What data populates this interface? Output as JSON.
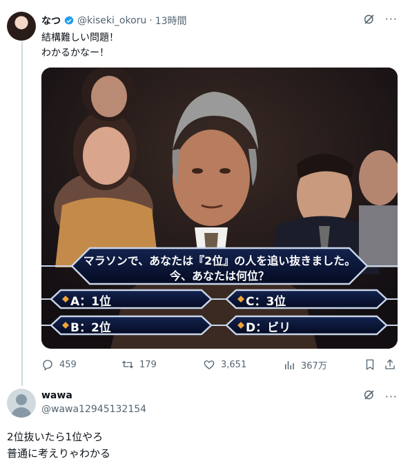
{
  "tweet": {
    "display_name": "なつ",
    "handle": "@kiseki_okoru",
    "separator": "·",
    "time": "13時間",
    "more": "···",
    "text_line1": "結構難しい問題！",
    "text_line2": "わかるかなー！"
  },
  "quiz": {
    "question_line1": "マラソンで、あなたは『2位』の人を追い抜きました。",
    "question_line2": "今、あなたは何位？",
    "answer_a": "A：1位",
    "answer_b": "B：2位",
    "answer_c": "C：3位",
    "answer_d": "D：ビリ"
  },
  "actions": {
    "replies": "459",
    "retweets": "179",
    "likes": "3,651",
    "views": "367万"
  },
  "reply": {
    "display_name": "wawa",
    "handle": "@wawa12945132154",
    "more": "···",
    "text_line1": "2位抜いたら1位やろ",
    "text_line2": "普通に考えりゃわかる"
  },
  "colors": {
    "accent": "#1d9bf0",
    "secondary_text": "#536471",
    "quiz_panel": "#0a1636",
    "quiz_border": "#c9d6ea"
  }
}
